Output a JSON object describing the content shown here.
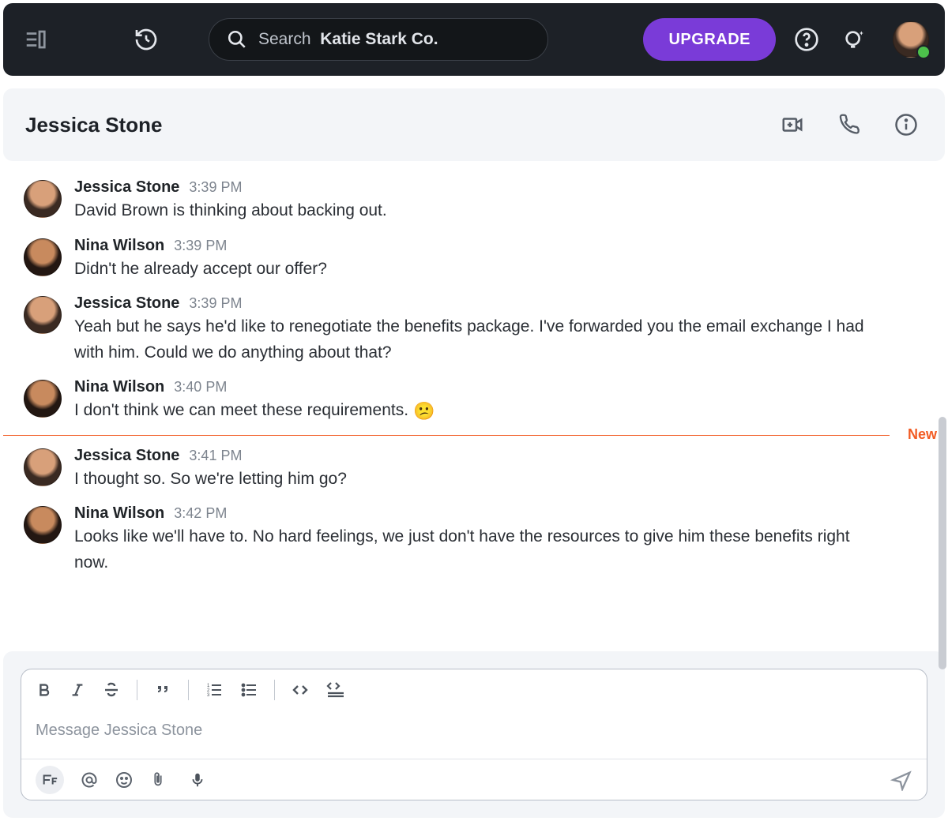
{
  "topbar": {
    "search_prefix": "Search",
    "search_workspace": "Katie Stark Co.",
    "upgrade_label": "UPGRADE"
  },
  "chat": {
    "title": "Jessica Stone"
  },
  "new_marker": "New",
  "composer": {
    "placeholder": "Message Jessica Stone"
  },
  "messages": [
    {
      "author": "Jessica Stone",
      "time": "3:39 PM",
      "text": "David Brown is thinking about backing out.",
      "avatar_variant": "a"
    },
    {
      "author": "Nina Wilson",
      "time": "3:39 PM",
      "text": "Didn't he already accept our offer?",
      "avatar_variant": "b"
    },
    {
      "author": "Jessica Stone",
      "time": "3:39 PM",
      "text": "Yeah but he says he'd like to renegotiate the benefits package. I've forwarded you the email exchange I had with him. Could we do anything about that?",
      "avatar_variant": "a"
    },
    {
      "author": "Nina Wilson",
      "time": "3:40 PM",
      "text": "I don't think we can meet these requirements.",
      "emoji": "😕",
      "avatar_variant": "b",
      "new_after": true
    },
    {
      "author": "Jessica Stone",
      "time": "3:41 PM",
      "text": "I thought so. So we're letting him go?",
      "avatar_variant": "a"
    },
    {
      "author": "Nina Wilson",
      "time": "3:42 PM",
      "text": "Looks like we'll have to. No hard feelings, we just don't have the resources to give him these benefits right now.",
      "avatar_variant": "b"
    }
  ],
  "icons": {
    "sidebar_toggle": "sidebar-toggle-icon",
    "history": "history-icon",
    "search": "search-icon",
    "help": "help-icon",
    "sparkle": "sparkle-bulb-icon",
    "video_add": "video-add-icon",
    "phone": "phone-icon",
    "info": "info-icon",
    "bold": "bold-icon",
    "italic": "italic-icon",
    "strike": "strike-icon",
    "quote": "quote-icon",
    "ol": "ordered-list-icon",
    "ul": "unordered-list-icon",
    "code": "code-icon",
    "codeblock": "code-block-icon",
    "text_format": "text-format-icon",
    "mention": "mention-icon",
    "emoji_smile": "emoji-icon",
    "attach": "attachment-icon",
    "mic": "mic-icon",
    "send": "send-icon"
  }
}
